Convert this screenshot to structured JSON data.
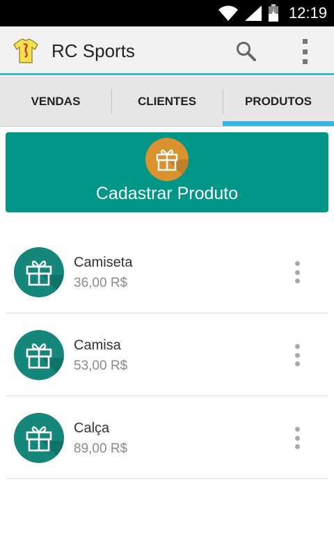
{
  "status_bar": {
    "time": "12:19",
    "icons": [
      "wifi-icon",
      "signal-icon",
      "battery-icon"
    ]
  },
  "app_bar": {
    "title": "RC Sports",
    "logo": "jersey-logo-icon",
    "actions": [
      "search-icon",
      "overflow-menu-icon"
    ]
  },
  "tabs": [
    {
      "label": "VENDAS",
      "active": false
    },
    {
      "label": "CLIENTES",
      "active": false
    },
    {
      "label": "PRODUTOS",
      "active": true
    }
  ],
  "register": {
    "label": "Cadastrar Produto",
    "icon": "gift-icon"
  },
  "products": [
    {
      "name": "Camiseta",
      "price": "36,00 R$",
      "icon": "gift-icon"
    },
    {
      "name": "Camisa",
      "price": "53,00 R$",
      "icon": "gift-icon"
    },
    {
      "name": "Calça",
      "price": "89,00 R$",
      "icon": "gift-icon"
    }
  ],
  "colors": {
    "accent": "#33b5e5",
    "primary": "#009688",
    "register_icon_bg": "#d9922e",
    "product_icon_bg": "#14867a"
  }
}
